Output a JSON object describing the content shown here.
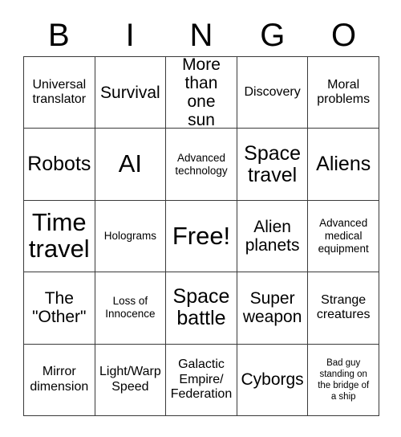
{
  "card": {
    "title": "BINGO",
    "header_letters": [
      "B",
      "I",
      "N",
      "G",
      "O"
    ],
    "free_space_label": "Free!",
    "columns": 5,
    "rows": 5,
    "border_color": "#3a3a3a",
    "background_color": "#ffffff",
    "text_color": "#000000"
  },
  "cells": [
    {
      "text": "Universal\ntranslator",
      "size": "md",
      "row": 1,
      "col": 1,
      "free": false
    },
    {
      "text": "Survival",
      "size": "lg",
      "row": 1,
      "col": 2,
      "free": false
    },
    {
      "text": "More\nthan one\nsun",
      "size": "lg",
      "row": 1,
      "col": 3,
      "free": false
    },
    {
      "text": "Discovery",
      "size": "md",
      "row": 1,
      "col": 4,
      "free": false
    },
    {
      "text": "Moral\nproblems",
      "size": "md",
      "row": 1,
      "col": 5,
      "free": false
    },
    {
      "text": "Robots",
      "size": "xl",
      "row": 2,
      "col": 1,
      "free": false
    },
    {
      "text": "AI",
      "size": "xxl",
      "row": 2,
      "col": 2,
      "free": false
    },
    {
      "text": "Advanced\ntechnology",
      "size": "sm",
      "row": 2,
      "col": 3,
      "free": false
    },
    {
      "text": "Space\ntravel",
      "size": "xl",
      "row": 2,
      "col": 4,
      "free": false
    },
    {
      "text": "Aliens",
      "size": "xl",
      "row": 2,
      "col": 5,
      "free": false
    },
    {
      "text": "Time\ntravel",
      "size": "xxl",
      "row": 3,
      "col": 1,
      "free": false
    },
    {
      "text": "Holograms",
      "size": "sm",
      "row": 3,
      "col": 2,
      "free": false
    },
    {
      "text": "Free!",
      "size": "xxl",
      "row": 3,
      "col": 3,
      "free": true
    },
    {
      "text": "Alien\nplanets",
      "size": "lg",
      "row": 3,
      "col": 4,
      "free": false
    },
    {
      "text": "Advanced\nmedical\nequipment",
      "size": "sm",
      "row": 3,
      "col": 5,
      "free": false
    },
    {
      "text": "The\n\"Other\"",
      "size": "lg",
      "row": 4,
      "col": 1,
      "free": false
    },
    {
      "text": "Loss of\nInnocence",
      "size": "sm",
      "row": 4,
      "col": 2,
      "free": false
    },
    {
      "text": "Space\nbattle",
      "size": "xl",
      "row": 4,
      "col": 3,
      "free": false
    },
    {
      "text": "Super\nweapon",
      "size": "lg",
      "row": 4,
      "col": 4,
      "free": false
    },
    {
      "text": "Strange\ncreatures",
      "size": "md",
      "row": 4,
      "col": 5,
      "free": false
    },
    {
      "text": "Mirror\ndimension",
      "size": "md",
      "row": 5,
      "col": 1,
      "free": false
    },
    {
      "text": "Light/Warp\nSpeed",
      "size": "md",
      "row": 5,
      "col": 2,
      "free": false
    },
    {
      "text": "Galactic\nEmpire/\nFederation",
      "size": "md",
      "row": 5,
      "col": 3,
      "free": false
    },
    {
      "text": "Cyborgs",
      "size": "lg",
      "row": 5,
      "col": 4,
      "free": false
    },
    {
      "text": "Bad guy\nstanding on\nthe bridge of\na ship",
      "size": "xs",
      "row": 5,
      "col": 5,
      "free": false
    }
  ]
}
